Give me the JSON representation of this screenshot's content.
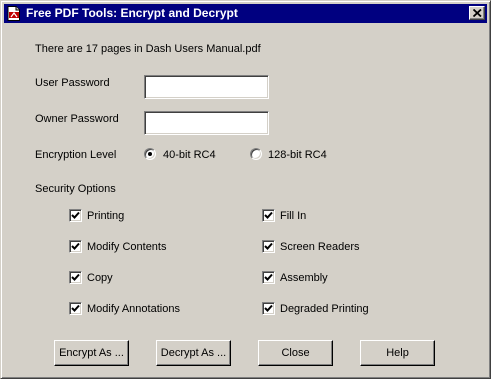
{
  "window": {
    "title": "Free PDF Tools:  Encrypt and Decrypt"
  },
  "info_text": "There are 17 pages in Dash Users Manual.pdf",
  "user_password": {
    "label": "User Password",
    "value": ""
  },
  "owner_password": {
    "label": "Owner Password",
    "value": ""
  },
  "encryption": {
    "label": "Encryption Level",
    "options": [
      {
        "label": "40-bit RC4",
        "selected": true
      },
      {
        "label": "128-bit RC4",
        "selected": false
      }
    ]
  },
  "security": {
    "label": "Security Options",
    "options": [
      {
        "label": "Printing",
        "checked": true
      },
      {
        "label": "Fill In",
        "checked": true
      },
      {
        "label": "Modify Contents",
        "checked": true
      },
      {
        "label": "Screen Readers",
        "checked": true
      },
      {
        "label": "Copy",
        "checked": true
      },
      {
        "label": "Assembly",
        "checked": true
      },
      {
        "label": "Modify Annotations",
        "checked": true
      },
      {
        "label": "Degraded Printing",
        "checked": true
      }
    ]
  },
  "buttons": {
    "encrypt": "Encrypt As ...",
    "decrypt": "Decrypt As ...",
    "close": "Close",
    "help": "Help"
  },
  "colors": {
    "titlebar": "#000080",
    "face": "#d4d0c8"
  },
  "icons": {
    "app": "pdf-document-icon",
    "close": "close-icon",
    "check": "checkmark-icon"
  }
}
